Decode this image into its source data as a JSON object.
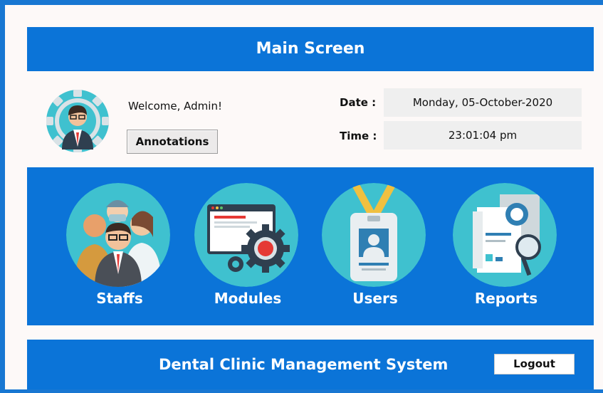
{
  "window": {
    "title": "Main Screen"
  },
  "header": {
    "welcome_text": "Welcome, Admin!",
    "annotations_label": "Annotations",
    "date_label": "Date :",
    "date_value": "Monday, 05-October-2020",
    "time_label": "Time :",
    "time_value": "23:01:04 pm"
  },
  "menu": {
    "items": [
      {
        "label": "Staffs",
        "icon": "staff-group-icon"
      },
      {
        "label": "Modules",
        "icon": "modules-gear-icon"
      },
      {
        "label": "Users",
        "icon": "id-badge-icon"
      },
      {
        "label": "Reports",
        "icon": "report-document-icon"
      }
    ]
  },
  "footer": {
    "system_title": "Dental Clinic Management System",
    "logout_label": "Logout"
  },
  "colors": {
    "brand_blue": "#0b74d8",
    "teal": "#3fc1cf",
    "background": "#fdf9f8"
  }
}
